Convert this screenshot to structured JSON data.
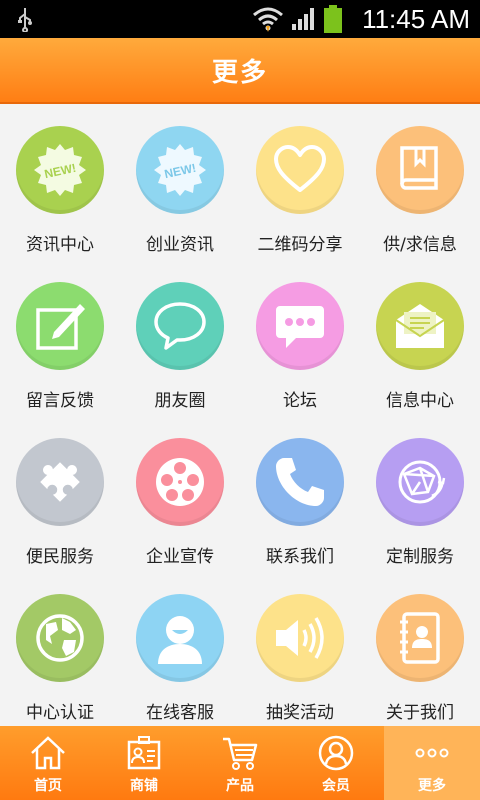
{
  "status_bar": {
    "time": "11:45 AM"
  },
  "header": {
    "title": "更多"
  },
  "grid": {
    "items": [
      {
        "label": "资讯中心",
        "icon": "new-badge-icon",
        "color": "#a9d14f"
      },
      {
        "label": "创业资讯",
        "icon": "new-badge-icon",
        "color": "#8fd6f1"
      },
      {
        "label": "二维码分享",
        "icon": "heart-icon",
        "color": "#fde28a"
      },
      {
        "label": "供/求信息",
        "icon": "book-icon",
        "color": "#fcc07a"
      },
      {
        "label": "留言反馈",
        "icon": "edit-note-icon",
        "color": "#8cdc6f"
      },
      {
        "label": "朋友圈",
        "icon": "speech-bubble-icon",
        "color": "#5fd0b9"
      },
      {
        "label": "论坛",
        "icon": "chat-dots-icon",
        "color": "#f59ce3"
      },
      {
        "label": "信息中心",
        "icon": "envelope-icon",
        "color": "#c7d451"
      },
      {
        "label": "便民服务",
        "icon": "puzzle-icon",
        "color": "#c2c7cf"
      },
      {
        "label": "企业宣传",
        "icon": "film-reel-icon",
        "color": "#fa8f9c"
      },
      {
        "label": "联系我们",
        "icon": "phone-icon",
        "color": "#8ab6ee"
      },
      {
        "label": "定制服务",
        "icon": "globe-network-icon",
        "color": "#b69ef2"
      },
      {
        "label": "中心认证",
        "icon": "world-globe-icon",
        "color": "#a3c966"
      },
      {
        "label": "在线客服",
        "icon": "user-face-icon",
        "color": "#8ed4f3"
      },
      {
        "label": "抽奖活动",
        "icon": "speaker-icon",
        "color": "#fde28a"
      },
      {
        "label": "关于我们",
        "icon": "contact-book-icon",
        "color": "#fcc07a"
      }
    ]
  },
  "tabbar": {
    "tabs": [
      {
        "label": "首页",
        "icon": "home-icon"
      },
      {
        "label": "商铺",
        "icon": "shop-card-icon"
      },
      {
        "label": "产品",
        "icon": "cart-icon"
      },
      {
        "label": "会员",
        "icon": "member-icon"
      },
      {
        "label": "更多",
        "icon": "more-dots-icon",
        "active": true
      }
    ]
  }
}
